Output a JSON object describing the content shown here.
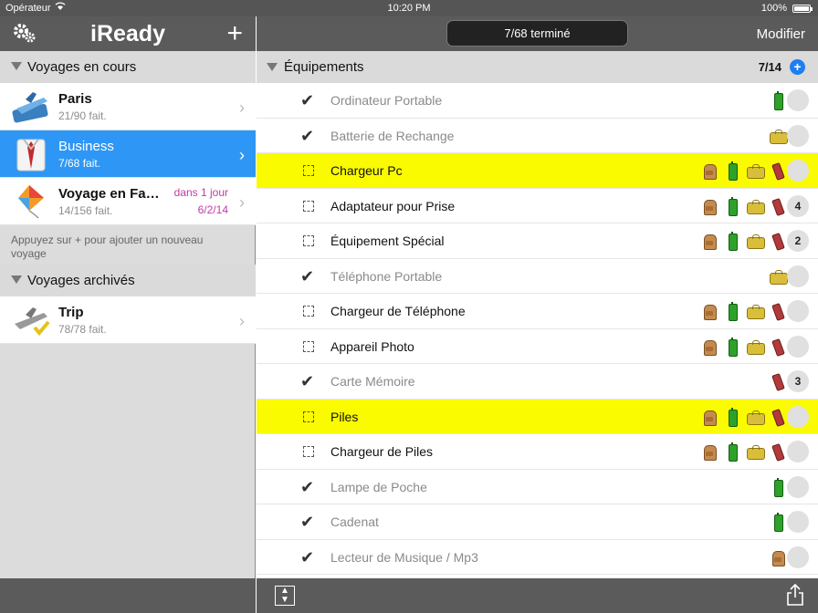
{
  "status": {
    "carrier": "Opérateur",
    "time": "10:20 PM",
    "battery": "100%"
  },
  "left": {
    "app_title": "iReady",
    "add_icon": "plus-icon",
    "settings_icon": "gear-icon",
    "current_section": "Voyages en cours",
    "archived_section": "Voyages archivés",
    "hint": "Appuyez sur + pour ajouter un nouveau voyage",
    "current_trips": [
      {
        "name": "Paris",
        "progress": "21/90 fait.",
        "icon": "airplane-icon"
      },
      {
        "name": "Business",
        "progress": "7/68 fait.",
        "icon": "suit-icon",
        "selected": true
      },
      {
        "name": "Voyage en Fa…",
        "progress": "14/156 fait.",
        "icon": "kite-icon",
        "due": "dans 1 jour",
        "due_date": "6/2/14"
      }
    ],
    "archived_trips": [
      {
        "name": "Trip",
        "progress": "78/78 fait.",
        "icon": "airplane-archived-icon"
      }
    ]
  },
  "right": {
    "progress_label": "7/68 terminé",
    "edit_label": "Modifier",
    "category": {
      "name": "Équipements",
      "count": "7/14"
    },
    "items": [
      {
        "name": "Ordinateur Portable",
        "done": true,
        "highlight": false,
        "icons": [
          "suitcase"
        ],
        "badge": ""
      },
      {
        "name": "Batterie de Rechange",
        "done": true,
        "highlight": false,
        "icons": [
          "bag"
        ],
        "badge": ""
      },
      {
        "name": "Chargeur Pc",
        "done": false,
        "highlight": true,
        "icons": [
          "backpack",
          "suitcase",
          "bag",
          "phone"
        ],
        "badge": ""
      },
      {
        "name": "Adaptateur pour Prise",
        "done": false,
        "highlight": false,
        "icons": [
          "backpack",
          "suitcase",
          "bag",
          "phone"
        ],
        "badge": "4"
      },
      {
        "name": "Équipement Spécial",
        "done": false,
        "highlight": false,
        "icons": [
          "backpack",
          "suitcase",
          "bag",
          "phone"
        ],
        "badge": "2"
      },
      {
        "name": "Téléphone Portable",
        "done": true,
        "highlight": false,
        "icons": [
          "bag"
        ],
        "badge": ""
      },
      {
        "name": "Chargeur de Téléphone",
        "done": false,
        "highlight": false,
        "icons": [
          "backpack",
          "suitcase",
          "bag",
          "phone"
        ],
        "badge": ""
      },
      {
        "name": "Appareil Photo",
        "done": false,
        "highlight": false,
        "icons": [
          "backpack",
          "suitcase",
          "bag",
          "phone"
        ],
        "badge": ""
      },
      {
        "name": "Carte Mémoire",
        "done": true,
        "highlight": false,
        "icons": [
          "phone"
        ],
        "badge": "3"
      },
      {
        "name": "Piles",
        "done": false,
        "highlight": true,
        "icons": [
          "backpack",
          "suitcase",
          "bag",
          "phone"
        ],
        "badge": ""
      },
      {
        "name": "Chargeur de Piles",
        "done": false,
        "highlight": false,
        "icons": [
          "backpack",
          "suitcase",
          "bag",
          "phone"
        ],
        "badge": ""
      },
      {
        "name": "Lampe de Poche",
        "done": true,
        "highlight": false,
        "icons": [
          "suitcase"
        ],
        "badge": ""
      },
      {
        "name": "Cadenat",
        "done": true,
        "highlight": false,
        "icons": [
          "suitcase"
        ],
        "badge": ""
      },
      {
        "name": "Lecteur de Musique / Mp3",
        "done": true,
        "highlight": false,
        "icons": [
          "backpack"
        ],
        "badge": ""
      }
    ]
  },
  "colors": {
    "bar": "#5b5b5b",
    "selected": "#2e97f5",
    "highlight": "#fbfb00",
    "due": "#c23aa6"
  }
}
